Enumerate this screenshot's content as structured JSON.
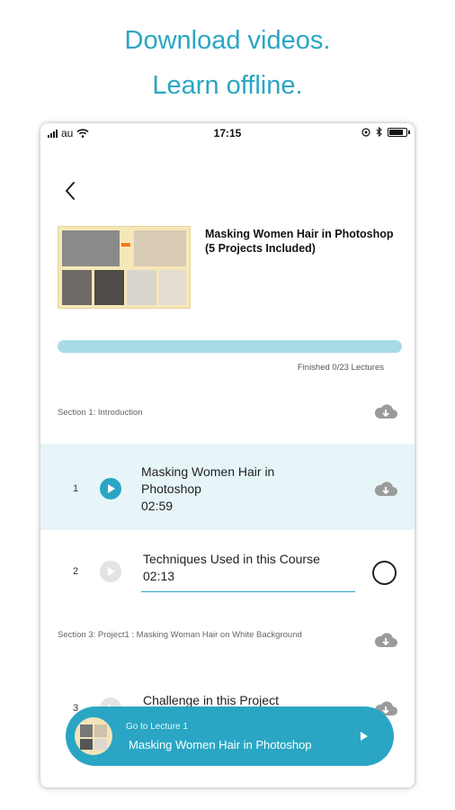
{
  "headline": {
    "line1": "Download videos.",
    "line2": "Learn offline."
  },
  "status_bar": {
    "carrier": "au",
    "time": "17:15"
  },
  "course": {
    "title": "Masking Women Hair in Photoshop (5 Projects Included)",
    "progress_fraction": 0.0,
    "progress_label": "Finished 0/23 Lectures"
  },
  "sections": [
    {
      "label": "Section 1: Introduction"
    },
    {
      "label": "Section 3: Project1 : Masking Woman Hair on White Background"
    }
  ],
  "lectures": [
    {
      "number": "1",
      "title": "Masking Women Hair in Photoshop",
      "duration": "02:59",
      "active": true
    },
    {
      "number": "2",
      "title": "Techniques Used in this Course",
      "duration": "02:13",
      "active": false
    },
    {
      "number": "3",
      "title": "Challenge in this Project",
      "duration": "",
      "active": false
    }
  ],
  "bottom_bar": {
    "caption": "Go to Lecture 1",
    "title": "Masking Women Hair in Photoshop"
  },
  "colors": {
    "accent": "#2aa6c4",
    "progress_track": "#a8dbe6",
    "active_row": "#e7f5f8"
  }
}
